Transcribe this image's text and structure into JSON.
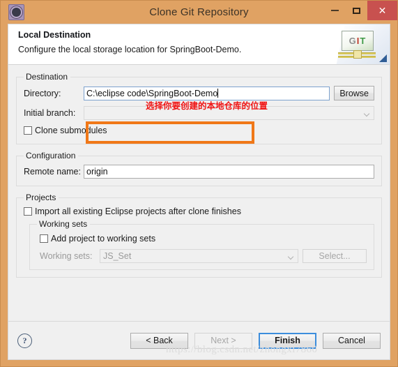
{
  "window": {
    "title": "Clone Git Repository",
    "icon": "gear-icon",
    "controls": {
      "minimize": "–",
      "maximize": "□",
      "close": "✕"
    },
    "accent_titlebar": "#e0a263",
    "accent_close": "#c8514f"
  },
  "banner": {
    "title": "Local Destination",
    "subtitle": "Configure the local storage location for SpringBoot-Demo.",
    "logo": {
      "g": "G",
      "i": "I",
      "t": "T"
    }
  },
  "destination": {
    "legend": "Destination",
    "directory_label": "Directory:",
    "directory_value": "C:\\eclipse code\\SpringBoot-Demo",
    "directory_placeholder": "",
    "browse_label": "Browse",
    "initial_branch_label": "Initial branch:",
    "initial_branch_value": "",
    "clone_submodules_label": "Clone submodules",
    "clone_submodules_checked": false
  },
  "configuration": {
    "legend": "Configuration",
    "remote_name_label": "Remote name:",
    "remote_name_value": "origin"
  },
  "projects": {
    "legend": "Projects",
    "import_label": "Import all existing Eclipse projects after clone finishes",
    "import_checked": false,
    "working_sets": {
      "legend": "Working sets",
      "add_label": "Add project to working sets",
      "add_checked": false,
      "sets_label": "Working sets:",
      "sets_value": "JS_Set",
      "select_label": "Select..."
    }
  },
  "annotation": {
    "text": "选择你要创建的本地仓库的位置",
    "color": "#f01414",
    "box_color": "#f07818"
  },
  "buttonbar": {
    "help": "?",
    "back_label": "< Back",
    "next_label": "Next >",
    "finish_label": "Finish",
    "cancel_label": "Cancel"
  },
  "watermark": "https://blog.csdn.net/zhongxi7860"
}
